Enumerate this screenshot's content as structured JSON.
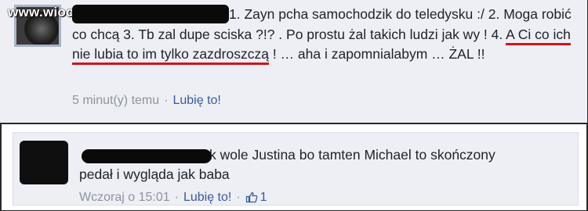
{
  "watermark": "www.wiocha.pl",
  "comments": [
    {
      "text_before": "1. Zayn pcha samochodzik do teledysku :/ 2. Moga robić co chcą 3. Tb zal dupe sciska ?!? . Po prostu żal takich ludzi jak wy ! 4. ",
      "highlighted": "A Ci co ich nie lubia to im tylko zazdroszczą",
      "text_after": " ! … aha i zapomnialabym … ŻAL !!",
      "time": "5 minut(y) temu",
      "like_label": "Lubię to!"
    },
    {
      "text": "k wole Justina bo tamten Michael to skończony pedał i wygląda jak baba",
      "time": "Wczoraj o 15:01",
      "like_label": "Lubię to!",
      "like_count": "1"
    }
  ],
  "colors": {
    "highlight_underline": "#d0141b",
    "link": "#3b5998",
    "meta": "#8d949e"
  }
}
